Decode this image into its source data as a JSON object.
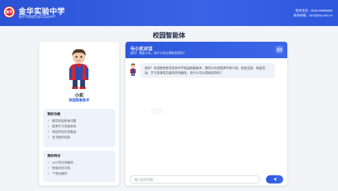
{
  "header": {
    "logo_text": "金华",
    "school_name": "金华实验中学",
    "school_sub": "金华市婺城区金华实验中学",
    "contact_phone": "联系电话：0555-88888888",
    "contact_email": "联系邮箱：info@jhsy.edu.cn"
  },
  "page_title": "校园智能体",
  "assistant": {
    "name": "小实",
    "role": "校园智能助手",
    "functions_title": "我的功能",
    "functions": [
      "解答校园相关问题",
      "提供学习资源查询",
      "校园活动信息推送",
      "生活服务指南"
    ],
    "features_title": "我的特点",
    "features": [
      "24小时在线服务",
      "智能语音识别",
      "个性化推荐"
    ]
  },
  "chat": {
    "title": "与小实对话",
    "subtitle": "您好！我是小实，有什么可以帮助您的吗？",
    "message": "您好！欢迎使用金华实验中学校园智能助手。我可以为您提供学校介绍、招生信息、校园活动、学习资源等方面的咨询服务。有什么可以帮助您的吗？",
    "input_placeholder": "输入您的问题...",
    "send_icon": "send-icon",
    "header_icon": "chat-icon"
  },
  "colors": {
    "primary": "#2e58dc",
    "accent": "#3a7bd5",
    "logo_red": "#d92525"
  }
}
